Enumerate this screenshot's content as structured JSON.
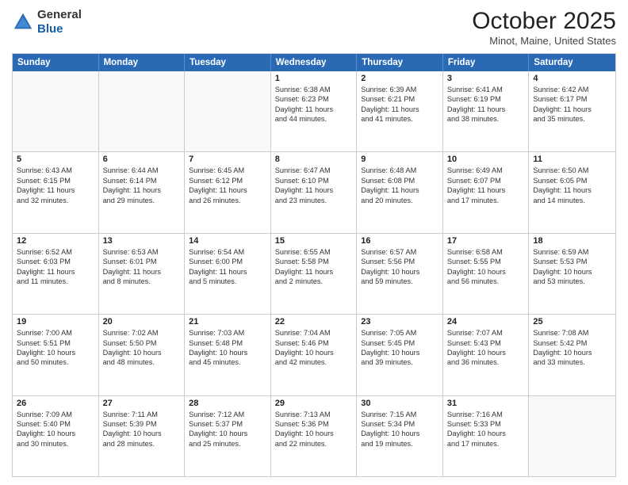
{
  "header": {
    "logo_general": "General",
    "logo_blue": "Blue",
    "month_title": "October 2025",
    "location": "Minot, Maine, United States"
  },
  "weekdays": [
    "Sunday",
    "Monday",
    "Tuesday",
    "Wednesday",
    "Thursday",
    "Friday",
    "Saturday"
  ],
  "rows": [
    [
      {
        "day": "",
        "lines": []
      },
      {
        "day": "",
        "lines": []
      },
      {
        "day": "",
        "lines": []
      },
      {
        "day": "1",
        "lines": [
          "Sunrise: 6:38 AM",
          "Sunset: 6:23 PM",
          "Daylight: 11 hours",
          "and 44 minutes."
        ]
      },
      {
        "day": "2",
        "lines": [
          "Sunrise: 6:39 AM",
          "Sunset: 6:21 PM",
          "Daylight: 11 hours",
          "and 41 minutes."
        ]
      },
      {
        "day": "3",
        "lines": [
          "Sunrise: 6:41 AM",
          "Sunset: 6:19 PM",
          "Daylight: 11 hours",
          "and 38 minutes."
        ]
      },
      {
        "day": "4",
        "lines": [
          "Sunrise: 6:42 AM",
          "Sunset: 6:17 PM",
          "Daylight: 11 hours",
          "and 35 minutes."
        ]
      }
    ],
    [
      {
        "day": "5",
        "lines": [
          "Sunrise: 6:43 AM",
          "Sunset: 6:15 PM",
          "Daylight: 11 hours",
          "and 32 minutes."
        ]
      },
      {
        "day": "6",
        "lines": [
          "Sunrise: 6:44 AM",
          "Sunset: 6:14 PM",
          "Daylight: 11 hours",
          "and 29 minutes."
        ]
      },
      {
        "day": "7",
        "lines": [
          "Sunrise: 6:45 AM",
          "Sunset: 6:12 PM",
          "Daylight: 11 hours",
          "and 26 minutes."
        ]
      },
      {
        "day": "8",
        "lines": [
          "Sunrise: 6:47 AM",
          "Sunset: 6:10 PM",
          "Daylight: 11 hours",
          "and 23 minutes."
        ]
      },
      {
        "day": "9",
        "lines": [
          "Sunrise: 6:48 AM",
          "Sunset: 6:08 PM",
          "Daylight: 11 hours",
          "and 20 minutes."
        ]
      },
      {
        "day": "10",
        "lines": [
          "Sunrise: 6:49 AM",
          "Sunset: 6:07 PM",
          "Daylight: 11 hours",
          "and 17 minutes."
        ]
      },
      {
        "day": "11",
        "lines": [
          "Sunrise: 6:50 AM",
          "Sunset: 6:05 PM",
          "Daylight: 11 hours",
          "and 14 minutes."
        ]
      }
    ],
    [
      {
        "day": "12",
        "lines": [
          "Sunrise: 6:52 AM",
          "Sunset: 6:03 PM",
          "Daylight: 11 hours",
          "and 11 minutes."
        ]
      },
      {
        "day": "13",
        "lines": [
          "Sunrise: 6:53 AM",
          "Sunset: 6:01 PM",
          "Daylight: 11 hours",
          "and 8 minutes."
        ]
      },
      {
        "day": "14",
        "lines": [
          "Sunrise: 6:54 AM",
          "Sunset: 6:00 PM",
          "Daylight: 11 hours",
          "and 5 minutes."
        ]
      },
      {
        "day": "15",
        "lines": [
          "Sunrise: 6:55 AM",
          "Sunset: 5:58 PM",
          "Daylight: 11 hours",
          "and 2 minutes."
        ]
      },
      {
        "day": "16",
        "lines": [
          "Sunrise: 6:57 AM",
          "Sunset: 5:56 PM",
          "Daylight: 10 hours",
          "and 59 minutes."
        ]
      },
      {
        "day": "17",
        "lines": [
          "Sunrise: 6:58 AM",
          "Sunset: 5:55 PM",
          "Daylight: 10 hours",
          "and 56 minutes."
        ]
      },
      {
        "day": "18",
        "lines": [
          "Sunrise: 6:59 AM",
          "Sunset: 5:53 PM",
          "Daylight: 10 hours",
          "and 53 minutes."
        ]
      }
    ],
    [
      {
        "day": "19",
        "lines": [
          "Sunrise: 7:00 AM",
          "Sunset: 5:51 PM",
          "Daylight: 10 hours",
          "and 50 minutes."
        ]
      },
      {
        "day": "20",
        "lines": [
          "Sunrise: 7:02 AM",
          "Sunset: 5:50 PM",
          "Daylight: 10 hours",
          "and 48 minutes."
        ]
      },
      {
        "day": "21",
        "lines": [
          "Sunrise: 7:03 AM",
          "Sunset: 5:48 PM",
          "Daylight: 10 hours",
          "and 45 minutes."
        ]
      },
      {
        "day": "22",
        "lines": [
          "Sunrise: 7:04 AM",
          "Sunset: 5:46 PM",
          "Daylight: 10 hours",
          "and 42 minutes."
        ]
      },
      {
        "day": "23",
        "lines": [
          "Sunrise: 7:05 AM",
          "Sunset: 5:45 PM",
          "Daylight: 10 hours",
          "and 39 minutes."
        ]
      },
      {
        "day": "24",
        "lines": [
          "Sunrise: 7:07 AM",
          "Sunset: 5:43 PM",
          "Daylight: 10 hours",
          "and 36 minutes."
        ]
      },
      {
        "day": "25",
        "lines": [
          "Sunrise: 7:08 AM",
          "Sunset: 5:42 PM",
          "Daylight: 10 hours",
          "and 33 minutes."
        ]
      }
    ],
    [
      {
        "day": "26",
        "lines": [
          "Sunrise: 7:09 AM",
          "Sunset: 5:40 PM",
          "Daylight: 10 hours",
          "and 30 minutes."
        ]
      },
      {
        "day": "27",
        "lines": [
          "Sunrise: 7:11 AM",
          "Sunset: 5:39 PM",
          "Daylight: 10 hours",
          "and 28 minutes."
        ]
      },
      {
        "day": "28",
        "lines": [
          "Sunrise: 7:12 AM",
          "Sunset: 5:37 PM",
          "Daylight: 10 hours",
          "and 25 minutes."
        ]
      },
      {
        "day": "29",
        "lines": [
          "Sunrise: 7:13 AM",
          "Sunset: 5:36 PM",
          "Daylight: 10 hours",
          "and 22 minutes."
        ]
      },
      {
        "day": "30",
        "lines": [
          "Sunrise: 7:15 AM",
          "Sunset: 5:34 PM",
          "Daylight: 10 hours",
          "and 19 minutes."
        ]
      },
      {
        "day": "31",
        "lines": [
          "Sunrise: 7:16 AM",
          "Sunset: 5:33 PM",
          "Daylight: 10 hours",
          "and 17 minutes."
        ]
      },
      {
        "day": "",
        "lines": []
      }
    ]
  ]
}
